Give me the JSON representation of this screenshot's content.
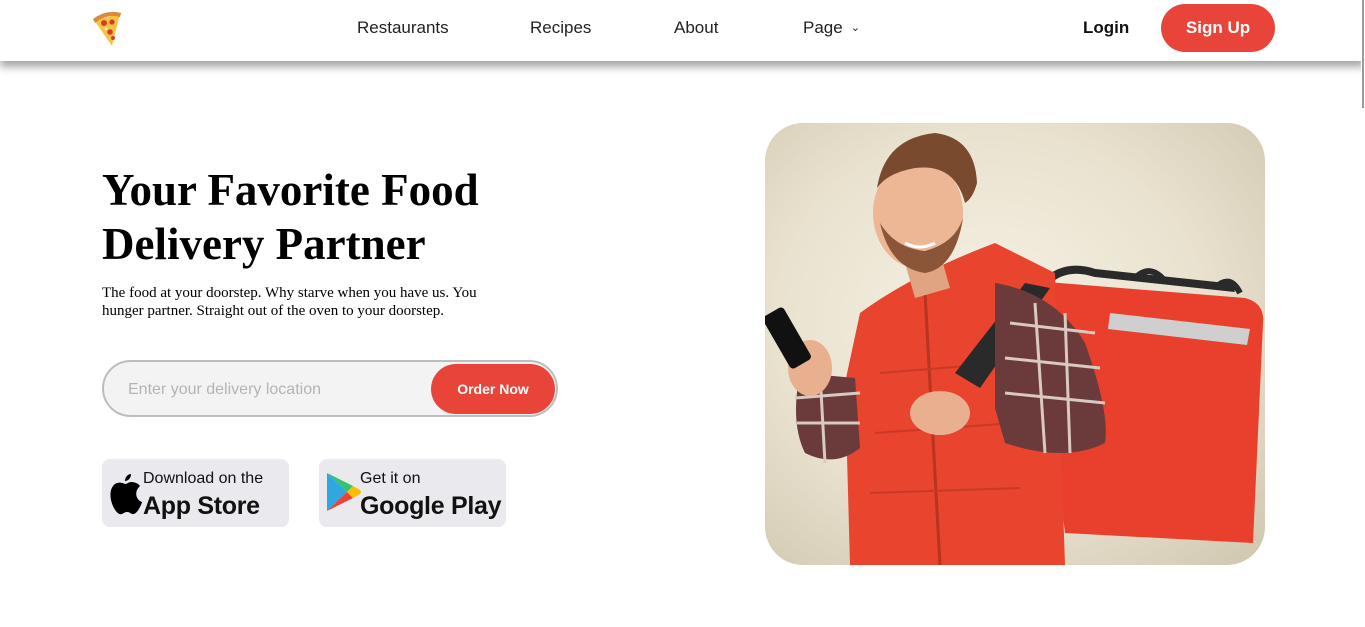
{
  "nav": {
    "logo_icon": "pizza-slice-icon",
    "links": [
      "Restaurants",
      "Recipes",
      "About",
      "Page"
    ],
    "page_dropdown_icon": "chevron-down-icon",
    "login_label": "Login",
    "signup_label": "Sign Up"
  },
  "hero": {
    "title": "Your Favorite Food Delivery Partner",
    "subtitle": "The food at your doorstep. Why starve when you have us. You hunger partner. Straight out of the oven to your doorstep.",
    "search": {
      "placeholder": "Enter your delivery location",
      "value": "",
      "button_label": "Order Now"
    },
    "badges": {
      "apple": {
        "icon": "apple-icon",
        "small": "Download on the",
        "big": "App Store"
      },
      "google": {
        "icon": "google-play-icon",
        "small": "Get it on",
        "big": "Google Play"
      }
    },
    "image": "delivery-man-with-red-backpack-photo"
  },
  "colors": {
    "accent": "#e8443a",
    "badge_bg": "#e9e9ee",
    "input_bg": "#f3f3f3"
  }
}
